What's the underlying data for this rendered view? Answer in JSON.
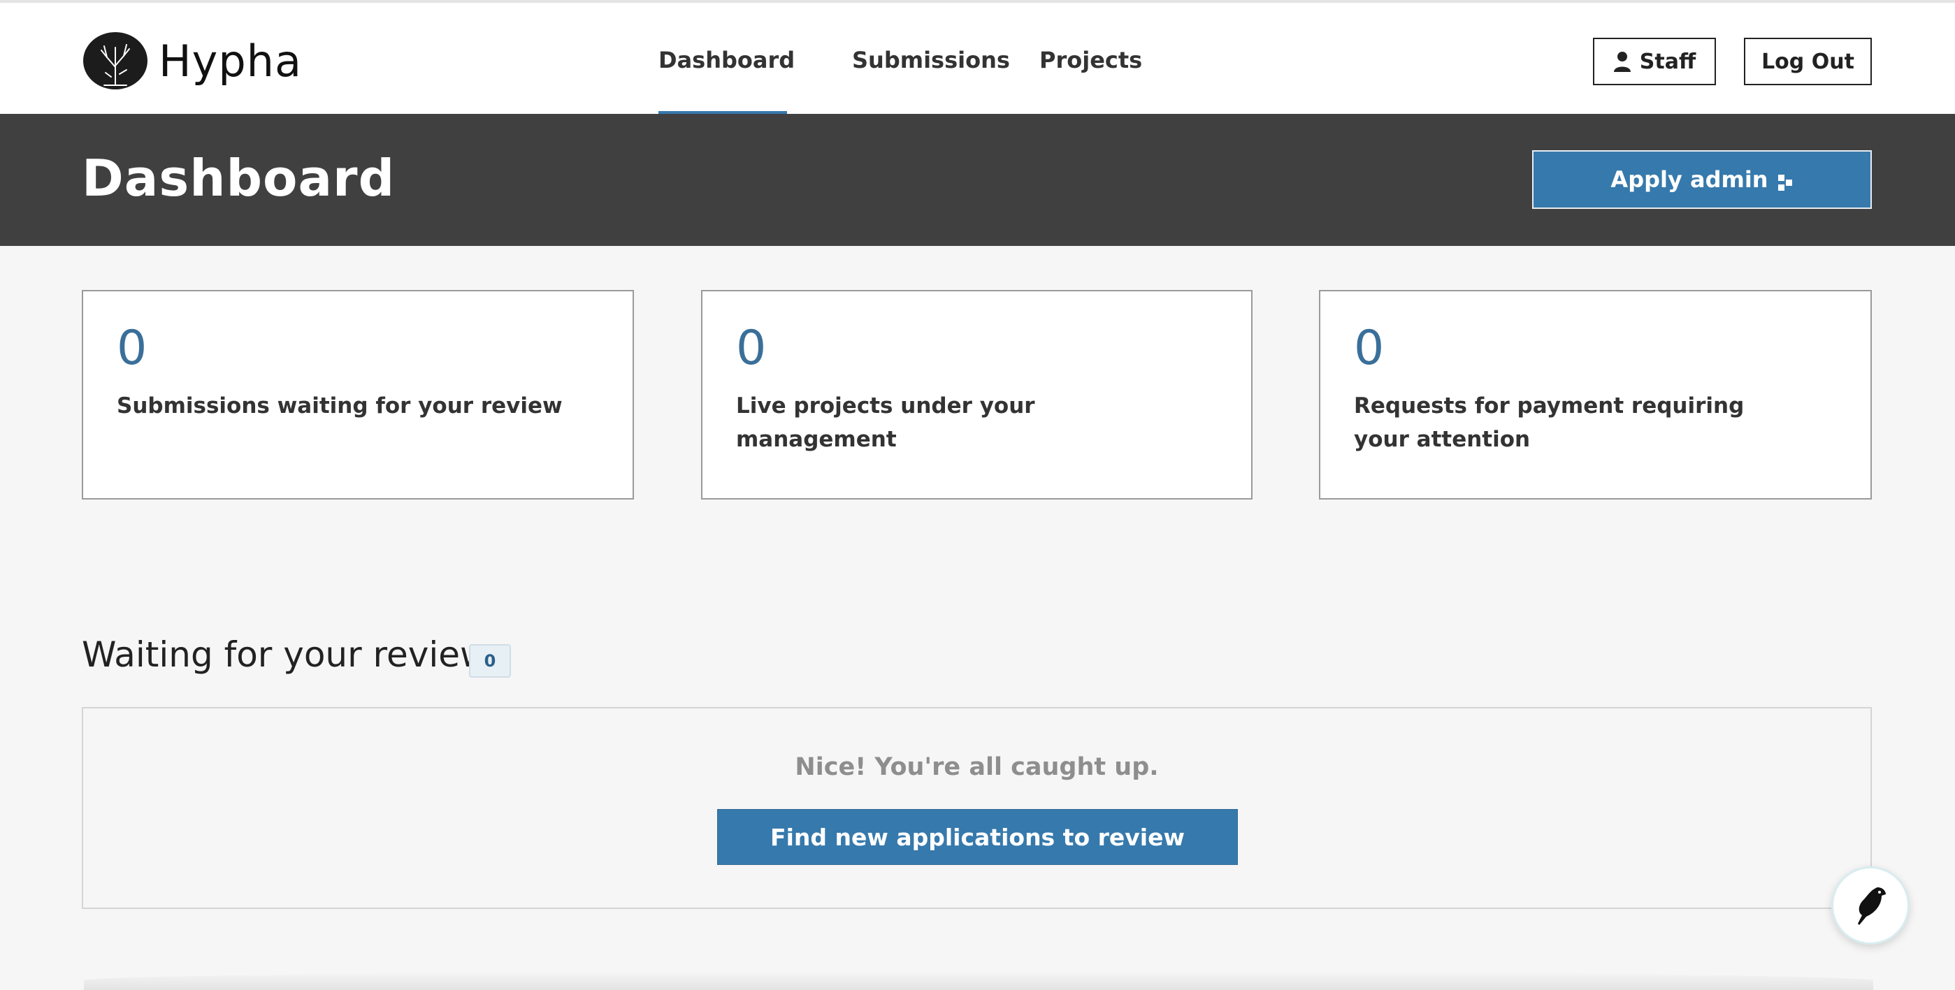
{
  "app": {
    "logo_text": "Hypha"
  },
  "nav": {
    "items": [
      {
        "label": "Dashboard",
        "active": true
      },
      {
        "label": "Submissions"
      },
      {
        "label": "Projects"
      }
    ]
  },
  "header_actions": {
    "staff_label": "Staff",
    "logout_label": "Log Out"
  },
  "hero": {
    "title": "Dashboard",
    "apply_label": "Apply admin"
  },
  "cards": [
    {
      "count": "0",
      "label": "Submissions waiting for your review"
    },
    {
      "count": "0",
      "label": "Live projects under your management"
    },
    {
      "count": "0",
      "label": "Requests for payment requiring your attention"
    }
  ],
  "review_section": {
    "title": "Waiting for your review",
    "count": "0",
    "empty_message": "Nice! You're all caught up.",
    "find_button_label": "Find new applications to review"
  },
  "colors": {
    "accent": "#3679ac",
    "hero_bg": "#404040",
    "page_bg": "#f6f6f6",
    "count_text": "#3a6f99"
  },
  "icons": [
    "hypha-logo-icon",
    "person-icon",
    "apply-admin-icon",
    "wagtail-bird-icon"
  ]
}
